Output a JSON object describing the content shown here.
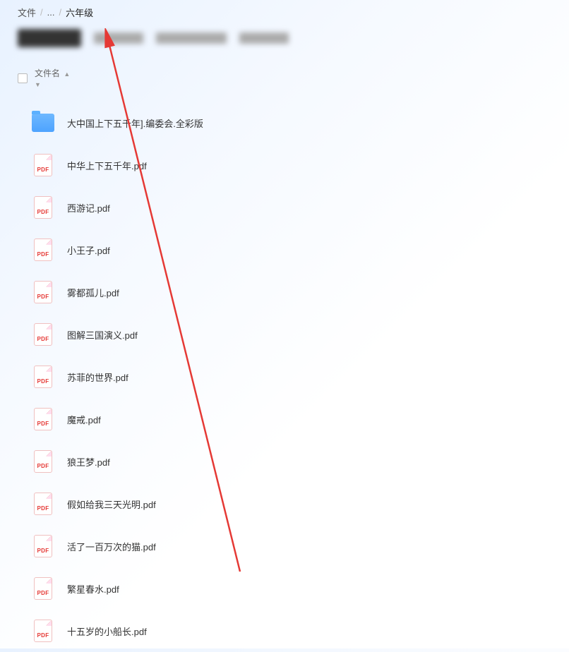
{
  "breadcrumb": {
    "root": "文件",
    "ellipsis": "...",
    "current": "六年级"
  },
  "list_header": {
    "name_label": "文件名"
  },
  "pdf_badge": "PDF",
  "files": [
    {
      "type": "folder",
      "name": "大中国上下五千年].编委会.全彩版"
    },
    {
      "type": "pdf",
      "name": "中华上下五千年.pdf"
    },
    {
      "type": "pdf",
      "name": "西游记.pdf"
    },
    {
      "type": "pdf",
      "name": "小王子.pdf"
    },
    {
      "type": "pdf",
      "name": "雾都孤儿.pdf"
    },
    {
      "type": "pdf",
      "name": "图解三国演义.pdf"
    },
    {
      "type": "pdf",
      "name": "苏菲的世界.pdf"
    },
    {
      "type": "pdf",
      "name": "魔戒.pdf"
    },
    {
      "type": "pdf",
      "name": "狼王梦.pdf"
    },
    {
      "type": "pdf",
      "name": "假如给我三天光明.pdf"
    },
    {
      "type": "pdf",
      "name": "活了一百万次的猫.pdf"
    },
    {
      "type": "pdf",
      "name": "繁星春水.pdf"
    },
    {
      "type": "pdf",
      "name": "十五岁的小船长.pdf"
    }
  ]
}
